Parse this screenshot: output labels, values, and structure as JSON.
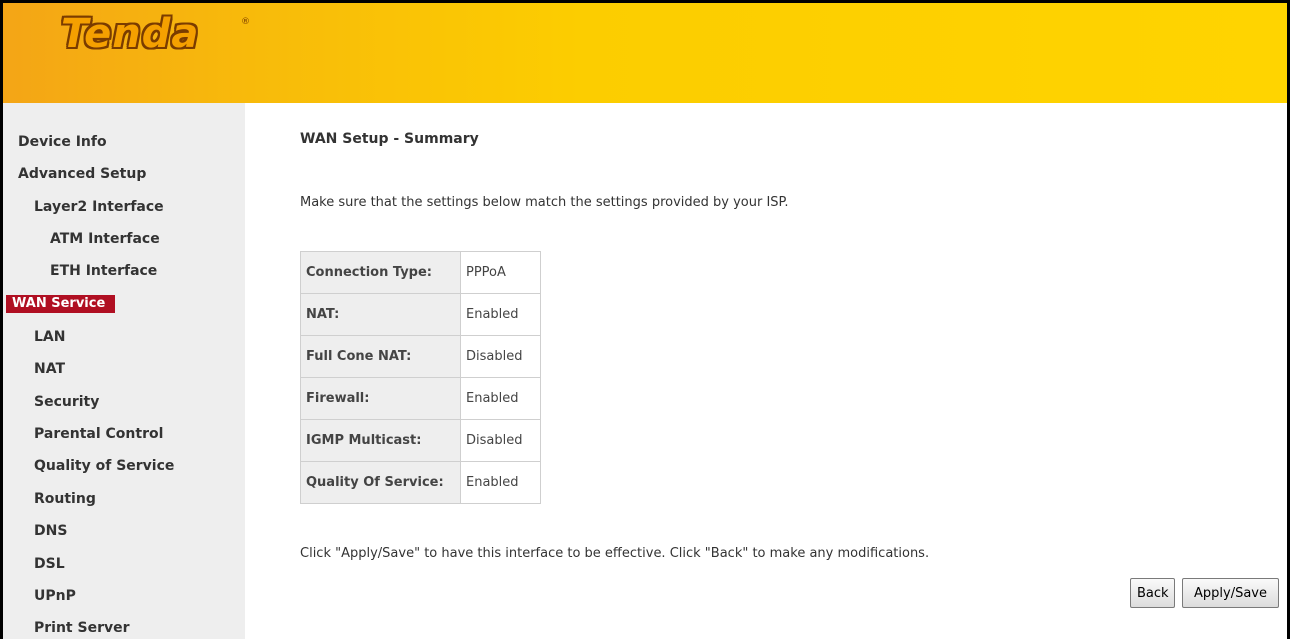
{
  "header": {
    "logo_text": "Tenda",
    "logo_mark": "®"
  },
  "sidebar": {
    "items": [
      {
        "label": "Device Info"
      },
      {
        "label": "Advanced Setup"
      },
      {
        "label": "Layer2 Interface"
      },
      {
        "label": "ATM Interface"
      },
      {
        "label": "ETH Interface"
      },
      {
        "label": "WAN Service",
        "active": true
      },
      {
        "label": "LAN"
      },
      {
        "label": "NAT"
      },
      {
        "label": "Security"
      },
      {
        "label": "Parental Control"
      },
      {
        "label": "Quality of Service"
      },
      {
        "label": "Routing"
      },
      {
        "label": "DNS"
      },
      {
        "label": "DSL"
      },
      {
        "label": "UPnP"
      },
      {
        "label": "Print Server"
      }
    ]
  },
  "main": {
    "title": "WAN Setup - Summary",
    "intro": "Make sure that the settings below match the settings provided by your ISP.",
    "summary": [
      {
        "label": "Connection Type:",
        "value": "PPPoA"
      },
      {
        "label": "NAT:",
        "value": "Enabled"
      },
      {
        "label": "Full Cone NAT:",
        "value": "Disabled"
      },
      {
        "label": "Firewall:",
        "value": "Enabled"
      },
      {
        "label": "IGMP Multicast:",
        "value": "Disabled"
      },
      {
        "label": "Quality Of Service:",
        "value": "Enabled"
      }
    ],
    "footer_note": "Click \"Apply/Save\" to have this interface to be effective. Click \"Back\" to make any modifications.",
    "back_label": "Back",
    "apply_label": "Apply/Save"
  },
  "colors": {
    "header_yellow": "#ffd400",
    "header_orange": "#f4a516",
    "active_nav": "#b00f22",
    "sidebar_bg": "#eeeeee"
  }
}
